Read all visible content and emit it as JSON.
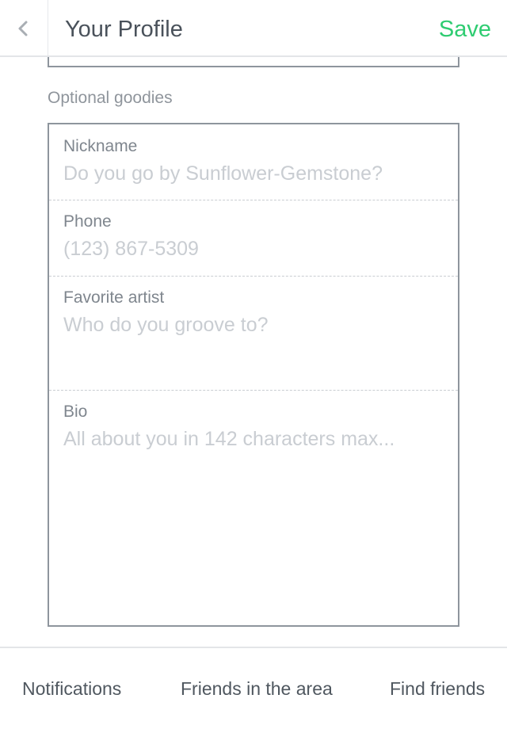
{
  "header": {
    "title": "Your Profile",
    "save_label": "Save",
    "back_icon": "chevron-left-icon"
  },
  "section": {
    "label": "Optional goodies"
  },
  "fields": {
    "nickname": {
      "label": "Nickname",
      "placeholder": "Do you go by Sunflower-Gemstone?",
      "value": ""
    },
    "phone": {
      "label": "Phone",
      "placeholder": "(123) 867-5309",
      "value": ""
    },
    "favorite_artist": {
      "label": "Favorite artist",
      "placeholder": "Who do you groove to?",
      "value": ""
    },
    "bio": {
      "label": "Bio",
      "placeholder": "All about you in 142 characters max...",
      "value": ""
    }
  },
  "tabs": [
    {
      "label": "Notifications"
    },
    {
      "label": "Friends in the area"
    },
    {
      "label": "Find friends"
    }
  ],
  "colors": {
    "accent": "#2ecc71",
    "text": "#4a525b",
    "muted": "#8f959c",
    "placeholder": "#c9cdd2",
    "border": "#8e959d"
  }
}
